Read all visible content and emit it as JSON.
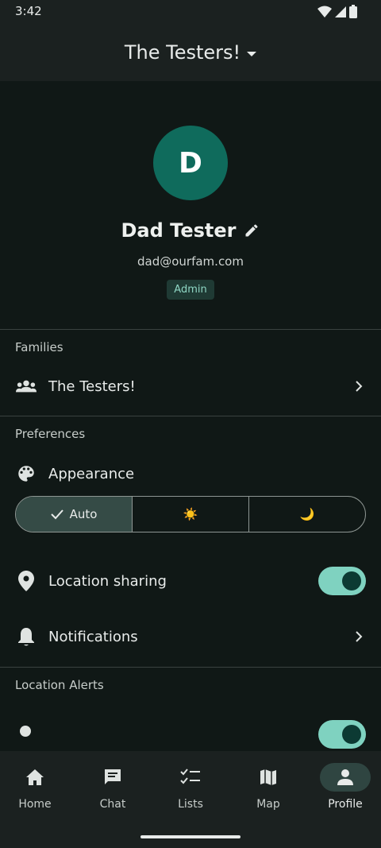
{
  "status": {
    "time": "3:42"
  },
  "header": {
    "title": "The Testers!"
  },
  "profile": {
    "initial": "D",
    "name": "Dad Tester",
    "email": "dad@ourfam.com",
    "role": "Admin"
  },
  "families": {
    "label": "Families",
    "items": [
      {
        "label": "The Testers!"
      }
    ]
  },
  "preferences": {
    "label": "Preferences",
    "appearance": {
      "label": "Appearance",
      "options": [
        {
          "label": "Auto",
          "selected": true
        },
        {
          "label": "☀️"
        },
        {
          "label": "🌙"
        }
      ]
    },
    "location_sharing": {
      "label": "Location sharing",
      "enabled": true
    },
    "notifications": {
      "label": "Notifications"
    }
  },
  "location_alerts": {
    "label": "Location Alerts"
  },
  "nav": {
    "items": [
      {
        "label": "Home",
        "icon": "home-icon"
      },
      {
        "label": "Chat",
        "icon": "chat-icon"
      },
      {
        "label": "Lists",
        "icon": "checklist-icon"
      },
      {
        "label": "Map",
        "icon": "map-icon"
      },
      {
        "label": "Profile",
        "icon": "person-icon",
        "active": true
      }
    ]
  },
  "colors": {
    "accent": "#7fd2c0",
    "avatar": "#0f6b5c",
    "background": "#101816",
    "surface": "#1b2120"
  }
}
